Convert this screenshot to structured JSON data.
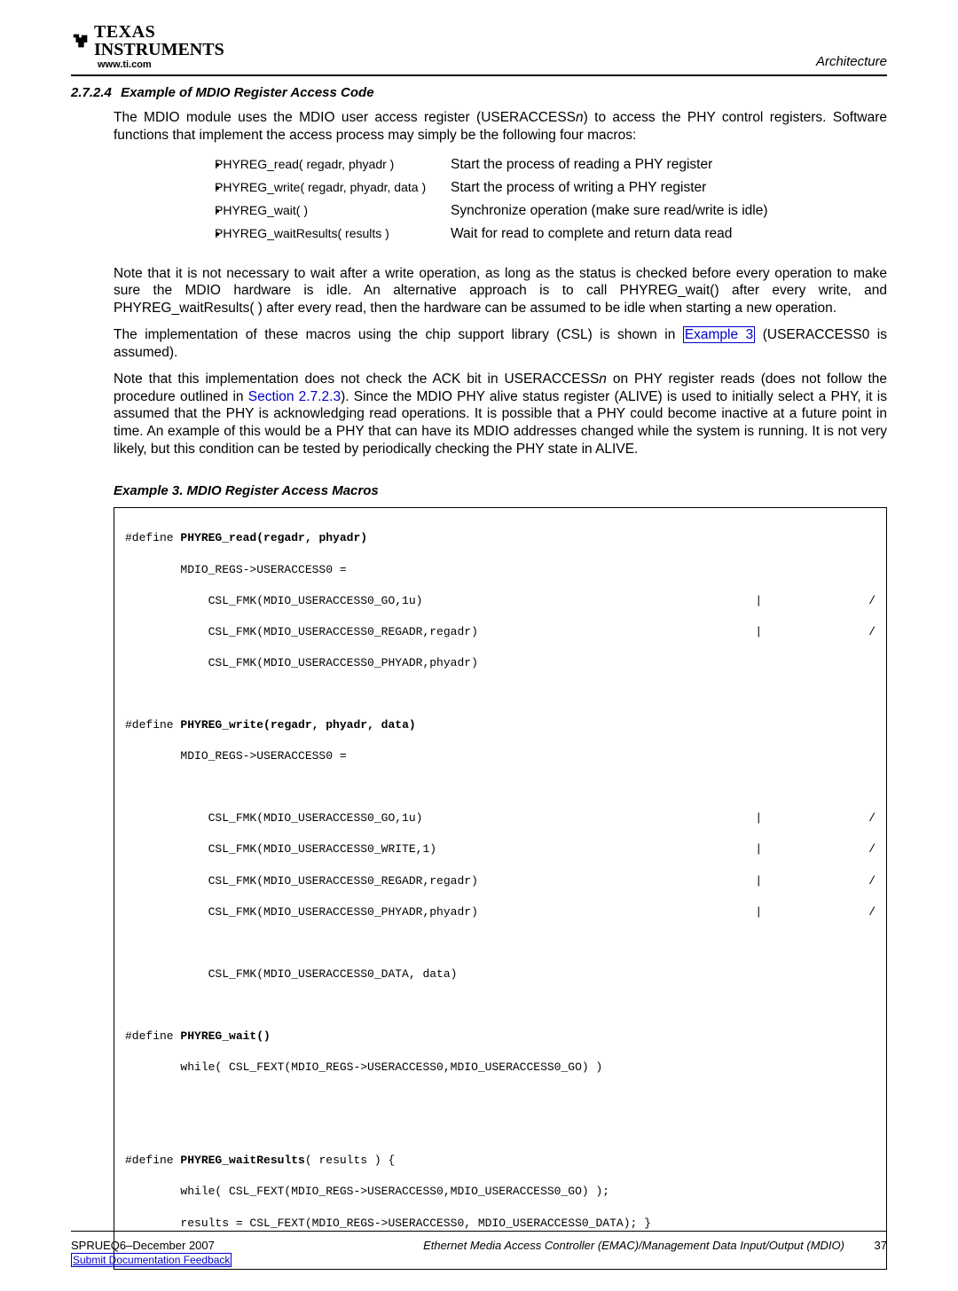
{
  "header": {
    "brand_top": "TEXAS",
    "brand_bottom": "INSTRUMENTS",
    "url": "www.ti.com",
    "right": "Architecture"
  },
  "section": {
    "number": "2.7.2.4",
    "title": "Example of MDIO Register Access Code"
  },
  "p1a": "The MDIO module uses the MDIO user access register (USERACCESS",
  "p1b": ") to access the PHY control registers. Software functions that implement the access process may simply be the following four macros:",
  "p1_italic": "n",
  "macros": [
    {
      "name": "PHYREG_read( regadr, phyadr )",
      "desc": "Start the process of reading a PHY register"
    },
    {
      "name": "PHYREG_write( regadr, phyadr, data )",
      "desc": "Start the process of writing a PHY register"
    },
    {
      "name": "PHYREG_wait( )",
      "desc": "Synchronize operation (make sure read/write is idle)"
    },
    {
      "name": "PHYREG_waitResults( results )",
      "desc": "Wait for read to complete and return data read"
    }
  ],
  "p2": "Note that it is not necessary to wait after a write operation, as long as the status is checked before every operation to make sure the MDIO hardware is idle. An alternative approach is to call PHYREG_wait() after every write, and PHYREG_waitResults( ) after every read, then the hardware can be assumed to be idle when starting a new operation.",
  "p3a": "The implementation of these macros using the chip support library (CSL) is shown in ",
  "p3_link": "Example 3",
  "p3b": " (USERACCESS0 is assumed).",
  "p4a": "Note that this implementation does not check the ACK bit in USERACCESS",
  "p4_italic": "n",
  "p4b": " on PHY register reads (does not follow the procedure outlined in ",
  "p4_link": "Section 2.7.2.3",
  "p4c": "). Since the MDIO PHY alive status register (ALIVE) is used to initially select a PHY, it is assumed that the PHY is acknowledging read operations. It is possible that a PHY could become inactive at a future point in time. An example of this would be a PHY that can have its MDIO addresses changed while the system is running. It is not very likely, but this condition can be tested by periodically checking the PHY state in ALIVE.",
  "example": {
    "title": "Example 3. MDIO Register Access Macros"
  },
  "code": {
    "def_read": "#define ",
    "def_read_b": "PHYREG_read(regadr, phyadr)",
    "read_l1": "        MDIO_REGS->USERACCESS0 =",
    "read_c1": "            CSL_FMK(MDIO_USERACCESS0_GO,1u)",
    "read_c2": "            CSL_FMK(MDIO_USERACCESS0_REGADR,regadr)",
    "read_l4": "            CSL_FMK(MDIO_USERACCESS0_PHYADR,phyadr)",
    "def_write": "#define ",
    "def_write_b": "PHYREG_write(regadr, phyadr, data)",
    "write_l1": "        MDIO_REGS->USERACCESS0 =",
    "write_c1": "            CSL_FMK(MDIO_USERACCESS0_GO,1u)",
    "write_c2": "            CSL_FMK(MDIO_USERACCESS0_WRITE,1)",
    "write_c3": "            CSL_FMK(MDIO_USERACCESS0_REGADR,regadr)",
    "write_c4": "            CSL_FMK(MDIO_USERACCESS0_PHYADR,phyadr)",
    "write_l6": "            CSL_FMK(MDIO_USERACCESS0_DATA, data)",
    "def_wait": "#define ",
    "def_wait_b": "PHYREG_wait()",
    "wait_l1": "        while( CSL_FEXT(MDIO_REGS->USERACCESS0,MDIO_USERACCESS0_GO) )",
    "def_wres": "#define ",
    "def_wres_b": "PHYREG_waitResults",
    "def_wres_tail": "( results ) {",
    "wres_l1": "        while( CSL_FEXT(MDIO_REGS->USERACCESS0,MDIO_USERACCESS0_GO) );",
    "wres_l2": "        results = CSL_FEXT(MDIO_REGS->USERACCESS0, MDIO_USERACCESS0_DATA); }"
  },
  "footer": {
    "docid": "SPRUEQ6–December 2007",
    "center": "Ethernet Media Access Controller (EMAC)/Management Data Input/Output (MDIO)",
    "page": "37",
    "feedback": "Submit Documentation Feedback"
  }
}
